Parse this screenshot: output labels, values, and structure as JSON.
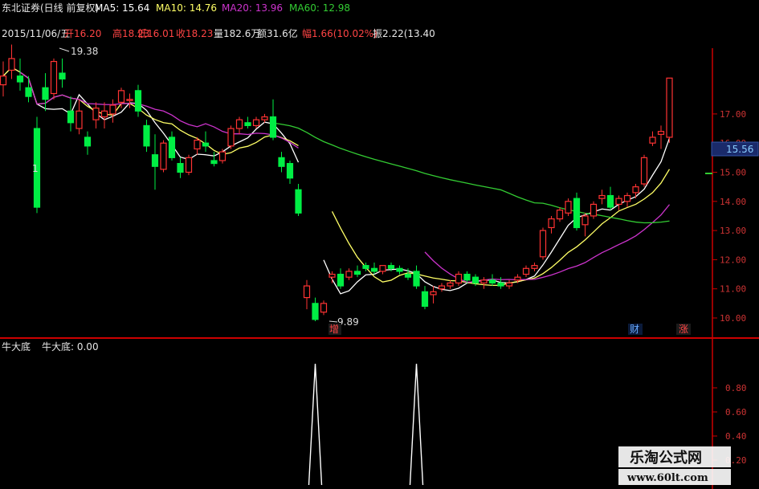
{
  "header": {
    "stock_name": "东北证券(日线 前复权)",
    "ma5": "MA5: 15.64",
    "ma10": "MA10: 14.76",
    "ma20": "MA20: 13.96",
    "ma60": "MA60: 12.98"
  },
  "ohlc_bar": {
    "date": "2015/11/06/五",
    "open": "开16.20",
    "high": "高18.23",
    "low": "低16.01",
    "close": "收18.23",
    "volume": "量182.6万",
    "amount": "额31.6亿",
    "change": "幅1.66(10.02%)",
    "amplitude": "振2.22(13.40"
  },
  "annotations": {
    "high_point": "19.38",
    "low_point": "9.89",
    "marker_zeng": "增",
    "marker_cai": "财",
    "marker_zhang": "涨",
    "current_price": "15.56",
    "small_one": "1"
  },
  "indicator": {
    "title": "牛大底",
    "value_label": "牛大底: 0.00"
  },
  "watermark": {
    "line1": "乐淘公式网",
    "line2": "www.60lt.com"
  },
  "colors": {
    "up": "#ff3333",
    "down": "#00ee44",
    "ma5": "#ffffff",
    "ma10": "#ffff66",
    "ma20": "#cc33cc",
    "ma60": "#33cc33",
    "axis": "#cc0000",
    "tick_text": "#cc3333"
  },
  "chart_data": {
    "type": "candlestick",
    "y_ticks": [
      "17.00",
      "16.00",
      "15.00",
      "14.00",
      "13.00",
      "12.00",
      "11.00",
      "10.00"
    ],
    "indicator_ticks": [
      "0.80",
      "0.60",
      "0.40",
      "0.20"
    ],
    "candles": [
      [
        18.0,
        18.8,
        17.6,
        18.3
      ],
      [
        18.5,
        19.38,
        18.2,
        18.9
      ],
      [
        18.3,
        18.9,
        17.8,
        18.1
      ],
      [
        17.9,
        18.3,
        17.4,
        17.6
      ],
      [
        16.5,
        16.9,
        13.6,
        13.8
      ],
      [
        17.9,
        18.4,
        17.1,
        17.5
      ],
      [
        17.7,
        18.9,
        17.5,
        18.8
      ],
      [
        18.4,
        18.9,
        17.9,
        18.2
      ],
      [
        17.1,
        17.6,
        16.4,
        16.7
      ],
      [
        16.5,
        17.5,
        16.3,
        17.1
      ],
      [
        16.2,
        16.4,
        15.6,
        15.9
      ],
      [
        16.8,
        17.4,
        16.5,
        17.2
      ],
      [
        16.9,
        17.4,
        16.5,
        17.1
      ],
      [
        17.0,
        17.5,
        16.7,
        17.3
      ],
      [
        17.4,
        17.9,
        17.2,
        17.8
      ],
      [
        17.5,
        17.7,
        17.2,
        17.5
      ],
      [
        17.8,
        18.0,
        16.9,
        17.1
      ],
      [
        16.6,
        16.8,
        15.7,
        15.9
      ],
      [
        15.6,
        16.3,
        14.4,
        15.2
      ],
      [
        15.1,
        16.1,
        15.0,
        16.0
      ],
      [
        16.2,
        16.4,
        15.4,
        15.5
      ],
      [
        15.3,
        15.5,
        14.8,
        15.0
      ],
      [
        15.0,
        15.6,
        14.9,
        15.5
      ],
      [
        15.8,
        16.2,
        15.6,
        16.1
      ],
      [
        16.0,
        16.4,
        15.7,
        15.9
      ],
      [
        15.4,
        15.7,
        15.2,
        15.3
      ],
      [
        15.4,
        15.8,
        15.3,
        15.7
      ],
      [
        15.9,
        16.6,
        15.8,
        16.5
      ],
      [
        16.5,
        16.9,
        16.3,
        16.8
      ],
      [
        16.7,
        16.9,
        16.5,
        16.6
      ],
      [
        16.6,
        16.9,
        16.5,
        16.8
      ],
      [
        16.8,
        17.0,
        16.7,
        16.9
      ],
      [
        16.9,
        17.5,
        16.1,
        16.2
      ],
      [
        15.5,
        15.7,
        15.0,
        15.2
      ],
      [
        15.3,
        15.4,
        14.6,
        14.8
      ],
      [
        14.4,
        14.6,
        13.5,
        13.6
      ],
      [
        10.7,
        11.3,
        10.3,
        11.1
      ],
      [
        10.5,
        10.7,
        9.89,
        9.95
      ],
      [
        10.2,
        10.6,
        10.1,
        10.5
      ],
      [
        11.4,
        11.6,
        11.2,
        11.5
      ],
      [
        11.5,
        11.7,
        11.0,
        11.1
      ],
      [
        11.4,
        11.7,
        11.3,
        11.6
      ],
      [
        11.6,
        11.8,
        11.4,
        11.5
      ],
      [
        11.8,
        11.9,
        11.6,
        11.7
      ],
      [
        11.7,
        11.9,
        11.5,
        11.6
      ],
      [
        11.6,
        11.8,
        11.5,
        11.8
      ],
      [
        11.8,
        11.9,
        11.6,
        11.7
      ],
      [
        11.7,
        11.8,
        11.5,
        11.6
      ],
      [
        11.5,
        11.7,
        11.3,
        11.4
      ],
      [
        11.6,
        11.8,
        11.0,
        11.1
      ],
      [
        10.9,
        11.1,
        10.3,
        10.4
      ],
      [
        10.8,
        11.1,
        10.5,
        10.9
      ],
      [
        11.0,
        11.2,
        10.9,
        11.1
      ],
      [
        11.1,
        11.3,
        11.0,
        11.2
      ],
      [
        11.2,
        11.6,
        11.1,
        11.5
      ],
      [
        11.5,
        11.6,
        11.2,
        11.3
      ],
      [
        11.4,
        11.5,
        11.1,
        11.2
      ],
      [
        11.2,
        11.4,
        11.0,
        11.3
      ],
      [
        11.3,
        11.5,
        11.1,
        11.2
      ],
      [
        11.2,
        11.4,
        11.0,
        11.1
      ],
      [
        11.1,
        11.3,
        11.0,
        11.2
      ],
      [
        11.3,
        11.5,
        11.2,
        11.4
      ],
      [
        11.5,
        11.8,
        11.4,
        11.7
      ],
      [
        11.7,
        11.9,
        11.6,
        11.8
      ],
      [
        12.1,
        13.1,
        12.0,
        13.0
      ],
      [
        13.1,
        13.5,
        12.9,
        13.4
      ],
      [
        13.4,
        13.8,
        13.3,
        13.7
      ],
      [
        13.6,
        14.1,
        13.5,
        14.0
      ],
      [
        14.1,
        14.3,
        13.0,
        13.1
      ],
      [
        13.2,
        13.6,
        12.8,
        13.5
      ],
      [
        13.5,
        14.0,
        13.4,
        13.9
      ],
      [
        14.1,
        14.4,
        13.9,
        14.2
      ],
      [
        14.2,
        14.5,
        13.7,
        13.8
      ],
      [
        13.9,
        14.2,
        13.7,
        14.1
      ],
      [
        14.0,
        14.3,
        13.8,
        14.2
      ],
      [
        14.3,
        14.6,
        14.1,
        14.5
      ],
      [
        14.6,
        15.6,
        14.5,
        15.5
      ],
      [
        16.0,
        16.4,
        15.9,
        16.2
      ],
      [
        16.3,
        16.6,
        15.8,
        16.4
      ],
      [
        16.2,
        18.23,
        16.01,
        18.23
      ]
    ],
    "indicator_spikes": [
      37,
      49
    ]
  }
}
